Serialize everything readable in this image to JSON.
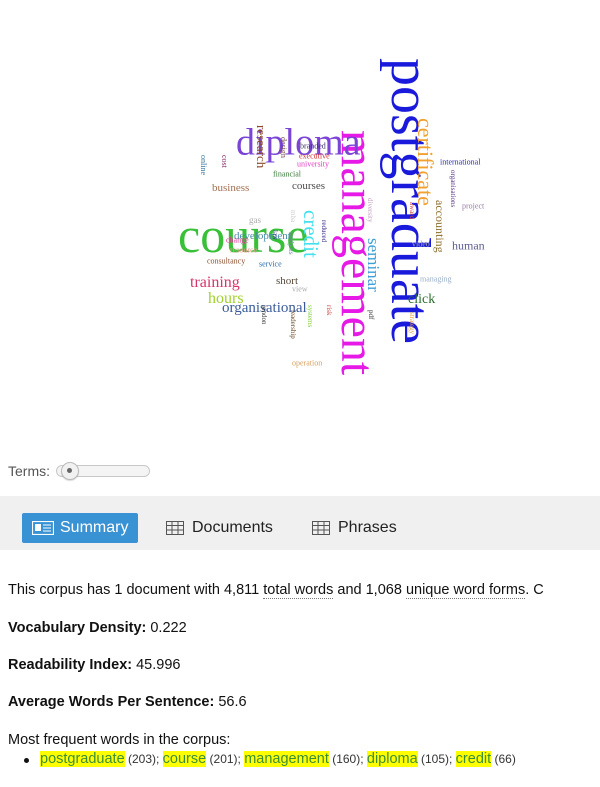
{
  "cloud_words": [
    {
      "text": "postgraduate",
      "color": "#1a1adc",
      "size": 56,
      "vertical": true
    },
    {
      "text": "management",
      "color": "#e619e6",
      "size": 48,
      "vertical": true
    },
    {
      "text": "course",
      "color": "#38c038",
      "size": 50,
      "vertical": false
    },
    {
      "text": "diploma",
      "color": "#7a44d6",
      "size": 38,
      "vertical": false
    },
    {
      "text": "certificate",
      "color": "#f2a030",
      "size": 22,
      "vertical": true
    },
    {
      "text": "credit",
      "color": "#44e0ee",
      "size": 21,
      "vertical": true
    },
    {
      "text": "seminar",
      "color": "#3ea0d8",
      "size": 17,
      "vertical": true
    },
    {
      "text": "training",
      "color": "#d8336a",
      "size": 16,
      "vertical": false
    },
    {
      "text": "hours",
      "color": "#a0d02e",
      "size": 16,
      "vertical": false
    },
    {
      "text": "organisational",
      "color": "#3a5c9a",
      "size": 15,
      "vertical": false
    },
    {
      "text": "research",
      "color": "#8c4a2a",
      "size": 13,
      "vertical": true
    },
    {
      "text": "click",
      "color": "#2a6e2e",
      "size": 14,
      "vertical": false
    },
    {
      "text": "accounting",
      "color": "#8c6e2a",
      "size": 12,
      "vertical": true
    },
    {
      "text": "human",
      "color": "#5e5e8e",
      "size": 12,
      "vertical": false
    },
    {
      "text": "courses",
      "color": "#4a4a4a",
      "size": 11,
      "vertical": false
    },
    {
      "text": "business",
      "color": "#a07050",
      "size": 11,
      "vertical": false
    },
    {
      "text": "development",
      "color": "#4a8aa8",
      "size": 11,
      "vertical": false
    },
    {
      "text": "short",
      "color": "#5a4a3a",
      "size": 11,
      "vertical": false
    },
    {
      "text": "design",
      "color": "#7a4a4a",
      "size": 8,
      "vertical": true
    },
    {
      "text": "branded",
      "color": "#3a2a6a",
      "size": 8,
      "vertical": false
    },
    {
      "text": "executive",
      "color": "#d43030",
      "size": 8,
      "vertical": false
    },
    {
      "text": "university",
      "color": "#e040c0",
      "size": 8,
      "vertical": false
    },
    {
      "text": "financial",
      "color": "#3a7a3a",
      "size": 8,
      "vertical": false
    },
    {
      "text": "international",
      "color": "#2a2aaa",
      "size": 8,
      "vertical": false
    },
    {
      "text": "online",
      "color": "#3a7aa0",
      "size": 8,
      "vertical": true
    },
    {
      "text": "cost",
      "color": "#8a2a6a",
      "size": 8,
      "vertical": true
    },
    {
      "text": "organisations",
      "color": "#5a3a8a",
      "size": 7,
      "vertical": true
    },
    {
      "text": "project",
      "color": "#9a7aaa",
      "size": 8,
      "vertical": false
    },
    {
      "text": "gas",
      "color": "#aaaaaa",
      "size": 9,
      "vertical": false
    },
    {
      "text": "change",
      "color": "#e03090",
      "size": 8,
      "vertical": false
    },
    {
      "text": "law",
      "color": "#3a3a8a",
      "size": 7,
      "vertical": true
    },
    {
      "text": "resource",
      "color": "#e8a090",
      "size": 8,
      "vertical": false
    },
    {
      "text": "analysis",
      "color": "#7a7aaa",
      "size": 7,
      "vertical": true
    },
    {
      "text": "consultancy",
      "color": "#8a5030",
      "size": 8,
      "vertical": false
    },
    {
      "text": "service",
      "color": "#2a6aaa",
      "size": 8,
      "vertical": false
    },
    {
      "text": "view",
      "color": "#aaaaaa",
      "size": 8,
      "vertical": false
    },
    {
      "text": "reduced",
      "color": "#3a2a8a",
      "size": 7,
      "vertical": true
    },
    {
      "text": "diversity",
      "color": "#c0a0c0",
      "size": 7,
      "vertical": true
    },
    {
      "text": "award",
      "color": "#d04040",
      "size": 7,
      "vertical": true
    },
    {
      "text": "video",
      "color": "#aaaaaa",
      "size": 8,
      "vertical": false
    },
    {
      "text": "managing",
      "color": "#9ab0c8",
      "size": 8,
      "vertical": false
    },
    {
      "text": "pdf",
      "color": "#3a3a3a",
      "size": 7,
      "vertical": true
    },
    {
      "text": "strategy",
      "color": "#e0a040",
      "size": 7,
      "vertical": true
    },
    {
      "text": "london",
      "color": "#3a3a3a",
      "size": 7,
      "vertical": true
    },
    {
      "text": "leadership",
      "color": "#6a4a2a",
      "size": 7,
      "vertical": true
    },
    {
      "text": "systems",
      "color": "#80d030",
      "size": 7,
      "vertical": true
    },
    {
      "text": "risk",
      "color": "#d04040",
      "size": 7,
      "vertical": true
    },
    {
      "text": "operation",
      "color": "#d8a060",
      "size": 8,
      "vertical": false
    },
    {
      "text": "mba",
      "color": "#cccccc",
      "size": 7,
      "vertical": true
    }
  ],
  "terms_label": "Terms:",
  "tabs": {
    "summary": "Summary",
    "documents": "Documents",
    "phrases": "Phrases"
  },
  "summary": {
    "corpus_prefix": "This corpus has 1 document with 4,811 ",
    "total_words": "total words",
    "corpus_mid": " and 1,068 ",
    "unique_forms": "unique word forms",
    "corpus_suffix": ". C",
    "vocab_label": "Vocabulary Density:",
    "vocab_value": " 0.222",
    "read_label": "Readability Index:",
    "read_value": " 45.996",
    "avg_label": "Average Words Per Sentence:",
    "avg_value": " 56.6",
    "freq_heading": "Most frequent words in the corpus:",
    "freq_words": [
      {
        "word": "postgraduate",
        "count": "(203)"
      },
      {
        "word": "course",
        "count": "(201)"
      },
      {
        "word": "management",
        "count": "(160)"
      },
      {
        "word": "diploma",
        "count": "(105)"
      },
      {
        "word": "credit",
        "count": "(66)"
      }
    ]
  }
}
